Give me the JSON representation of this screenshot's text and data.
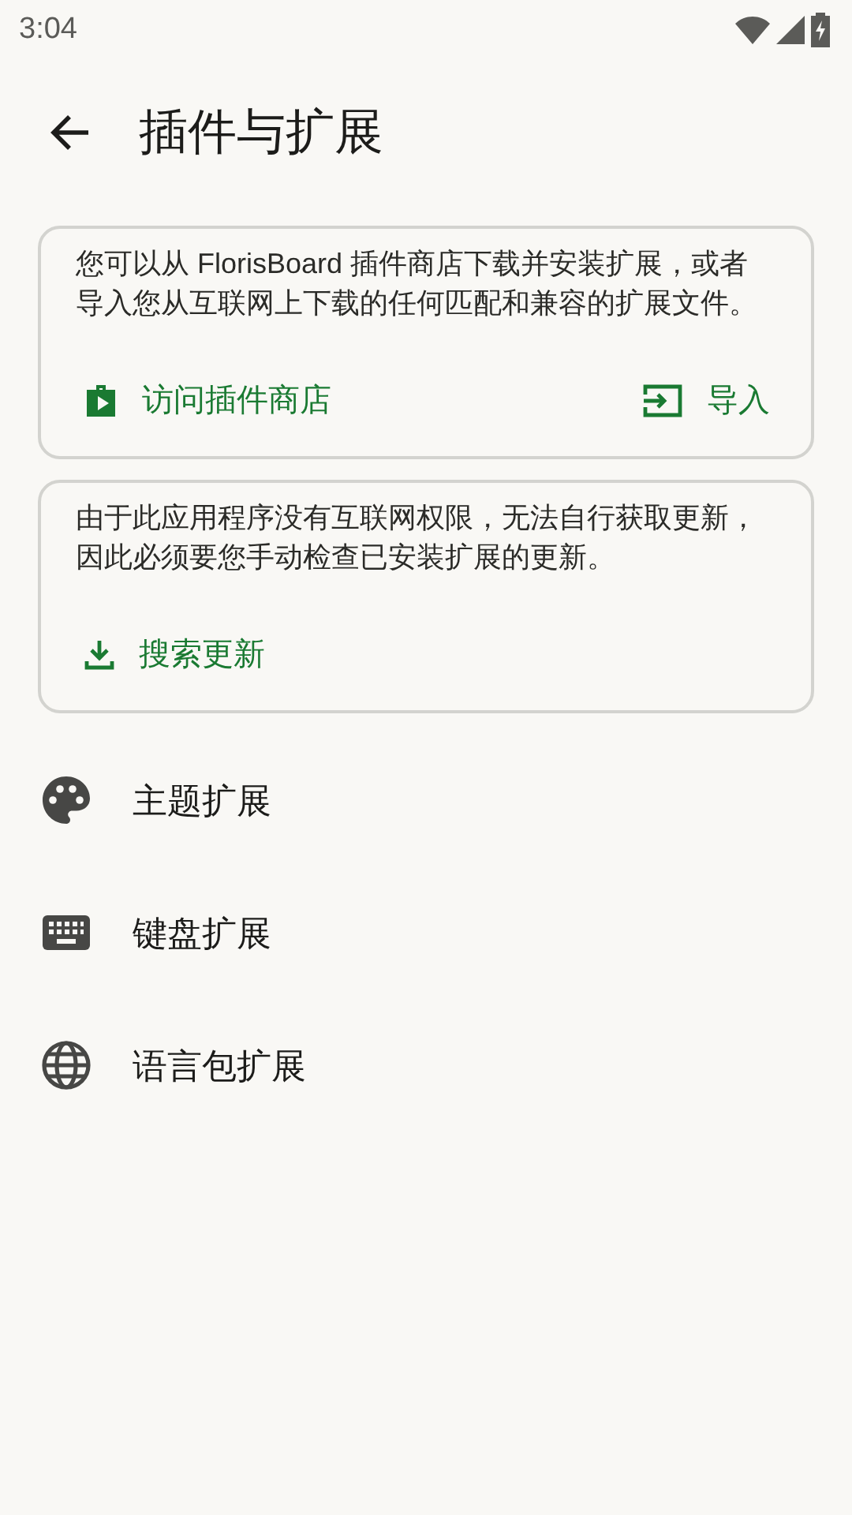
{
  "status_bar": {
    "time": "3:04"
  },
  "app_bar": {
    "title": "插件与扩展"
  },
  "cards": [
    {
      "text": "您可以从 FlorisBoard 插件商店下载并安装扩展，或者导入您从互联网上下载的任何匹配和兼容的扩展文件。",
      "actions": [
        {
          "kind": "store",
          "label": "访问插件商店"
        },
        {
          "kind": "import",
          "label": "导入"
        }
      ]
    },
    {
      "text": "由于此应用程序没有互联网权限，无法自行获取更新，因此必须要您手动检查已安装扩展的更新。",
      "actions": [
        {
          "kind": "download",
          "label": "搜索更新"
        }
      ]
    }
  ],
  "items": [
    {
      "kind": "theme",
      "label": "主题扩展"
    },
    {
      "kind": "keyboard",
      "label": "键盘扩展"
    },
    {
      "kind": "language",
      "label": "语言包扩展"
    }
  ]
}
